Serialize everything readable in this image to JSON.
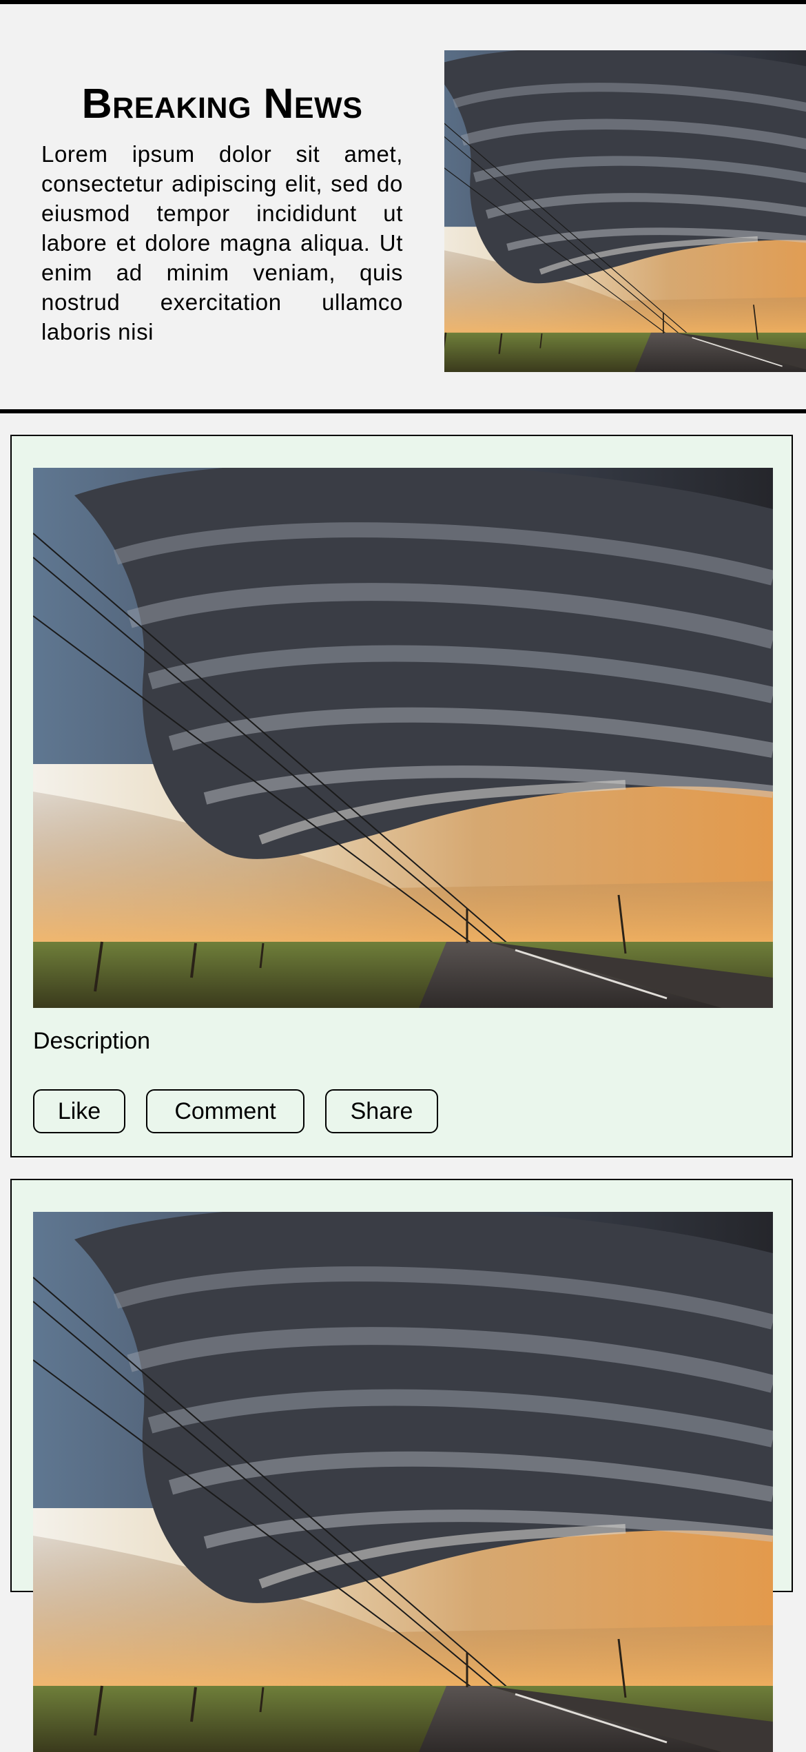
{
  "header": {
    "headline": "Breaking News",
    "blurb": "Lorem ipsum dolor sit amet, consectetur adipiscing elit, sed do eiusmod tempor incididunt ut labore et dolore magna aliqua. Ut enim ad minim veniam, quis nostrud exercitation ullamco laboris nisi"
  },
  "posts": [
    {
      "description": "Description",
      "actions": {
        "like": "Like",
        "comment": "Comment",
        "share": "Share"
      }
    },
    {
      "description": "",
      "actions": {
        "like": "",
        "comment": "",
        "share": ""
      }
    }
  ],
  "colors": {
    "page_background": "#f2f2f2",
    "card_background": "#eaf6ec",
    "border": "#000000"
  },
  "images": {
    "subject": "supercell-storm-over-road"
  }
}
